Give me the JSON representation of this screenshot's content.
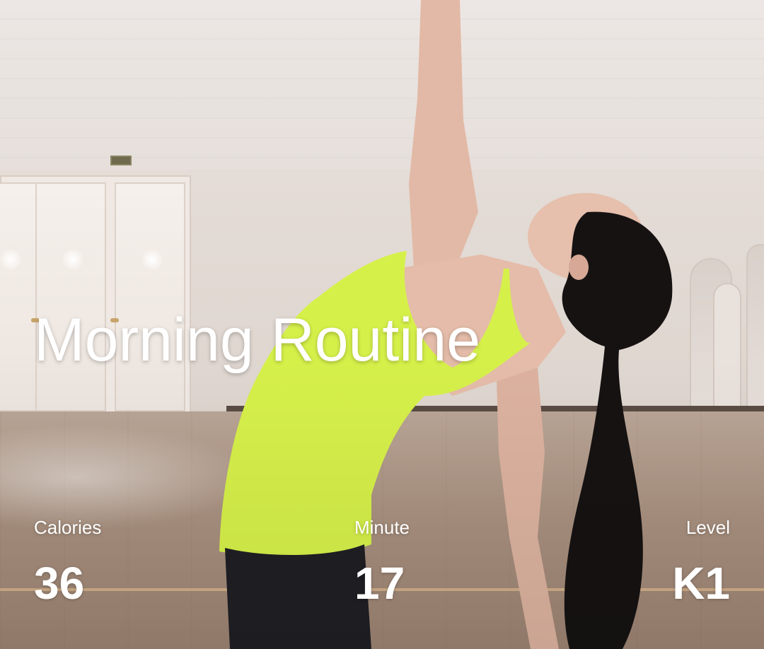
{
  "workout": {
    "title": "Morning Routine",
    "stats": [
      {
        "label": "Calories",
        "value": "36"
      },
      {
        "label": "Minute",
        "value": "17"
      },
      {
        "label": "Level",
        "value": "K1"
      }
    ]
  },
  "colors": {
    "overlay_text": "#ffffff",
    "top_color": "#d6f04a",
    "pants_color": "#1f1f24",
    "hair_color": "#161212"
  }
}
